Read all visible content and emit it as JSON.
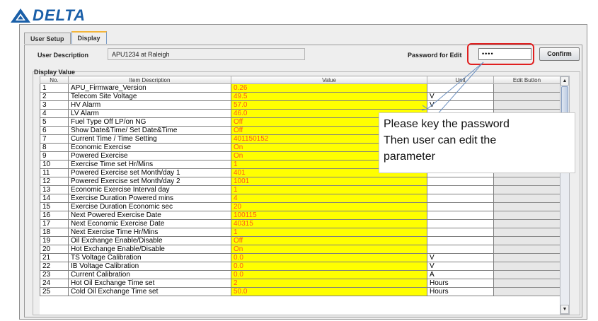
{
  "brand": {
    "name": "DELTA"
  },
  "tabs": [
    {
      "label": "User Setup",
      "active": false
    },
    {
      "label": "Display",
      "active": true
    }
  ],
  "user_description": {
    "label": "User Description",
    "value": "APU1234 at Raleigh"
  },
  "password": {
    "label": "Password for Edit",
    "value": "••••",
    "confirm_label": "Confirm"
  },
  "display_value": {
    "label": "Display Value",
    "columns": [
      "No.",
      "Item Description",
      "Value",
      "Unit",
      "Edit Button"
    ],
    "rows": [
      {
        "no": "1",
        "desc": "APU_Firmware_Version",
        "value": "0.26",
        "unit": ""
      },
      {
        "no": "2",
        "desc": "Telecom Site Voltage",
        "value": "49.5",
        "unit": "V"
      },
      {
        "no": "3",
        "desc": "HV Alarm",
        "value": "57.0",
        "unit": "V"
      },
      {
        "no": "4",
        "desc": "LV Alarm",
        "value": "46.0",
        "unit": ""
      },
      {
        "no": "5",
        "desc": "Fuel Type Off LP/on NG",
        "value": "Off",
        "unit": ""
      },
      {
        "no": "6",
        "desc": "Show Date&Time/ Set Date&Time",
        "value": "Off",
        "unit": ""
      },
      {
        "no": "7",
        "desc": "Current Time / Time Setting",
        "value": "401150152",
        "unit": ""
      },
      {
        "no": "8",
        "desc": "Economic Exercise",
        "value": "On",
        "unit": ""
      },
      {
        "no": "9",
        "desc": "Powered Exercise",
        "value": "On",
        "unit": ""
      },
      {
        "no": "10",
        "desc": "Exercise Time set Hr/Mins",
        "value": "1",
        "unit": ""
      },
      {
        "no": "11",
        "desc": "Powered Exercise set Month/day 1",
        "value": "401",
        "unit": ""
      },
      {
        "no": "12",
        "desc": "Powered Exercise set Month/day 2",
        "value": "1001",
        "unit": ""
      },
      {
        "no": "13",
        "desc": "Economic Exercise Interval day",
        "value": "1",
        "unit": ""
      },
      {
        "no": "14",
        "desc": "Exercise Duration Powered mins",
        "value": "4",
        "unit": ""
      },
      {
        "no": "15",
        "desc": "Exercise Duration Economic sec",
        "value": "20",
        "unit": ""
      },
      {
        "no": "16",
        "desc": "Next Powered Exercise Date",
        "value": "100115",
        "unit": ""
      },
      {
        "no": "17",
        "desc": "Next Economic Exercise Date",
        "value": "40315",
        "unit": ""
      },
      {
        "no": "18",
        "desc": "Next Exercise Time Hr/Mins",
        "value": "1",
        "unit": ""
      },
      {
        "no": "19",
        "desc": "Oil Exchange Enable/Disable",
        "value": "Off",
        "unit": ""
      },
      {
        "no": "20",
        "desc": "Hot Exchange Enable/Disable",
        "value": "On",
        "unit": ""
      },
      {
        "no": "21",
        "desc": "TS Voltage Calibration",
        "value": "0.0",
        "unit": "V"
      },
      {
        "no": "22",
        "desc": "IB Voltage Calibration",
        "value": "0.0",
        "unit": "V"
      },
      {
        "no": "23",
        "desc": "Current Calibration",
        "value": "0.0",
        "unit": "A"
      },
      {
        "no": "24",
        "desc": "Hot Oil Exchange Time set",
        "value": "2",
        "unit": "Hours"
      },
      {
        "no": "25",
        "desc": "Cold Oil Exchange Time set",
        "value": "50.0",
        "unit": "Hours"
      }
    ]
  },
  "callout": {
    "lines": [
      "Please key the password",
      "Then user can edit the",
      "parameter"
    ]
  },
  "colors": {
    "value_bg": "#ffff00",
    "value_text": "#ff5a1a",
    "highlight_border": "#e02020",
    "brand": "#1a5fa8"
  }
}
